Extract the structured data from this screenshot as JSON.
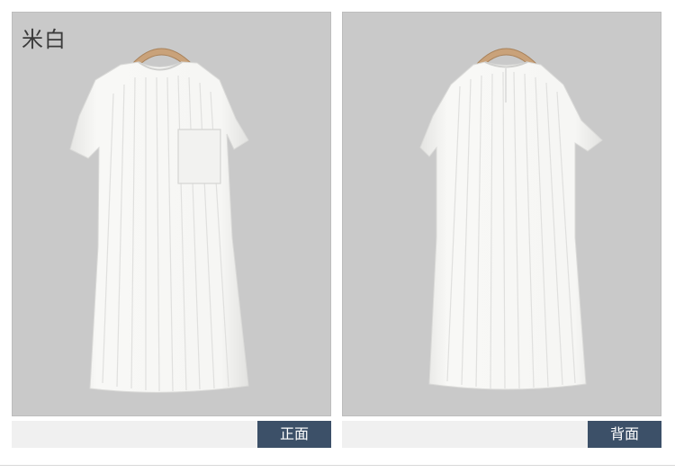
{
  "color_name": "米白",
  "views": {
    "front_label": "正面",
    "back_label": "背面"
  },
  "colors": {
    "panel_background": "#c9c9c9",
    "caption_background": "#3c5068",
    "caption_bar": "#f0f0f0",
    "garment": "#f7f7f5",
    "hanger": "#c9a27a"
  },
  "icons": [
    "wooden-hanger",
    "dress-front",
    "dress-back"
  ]
}
